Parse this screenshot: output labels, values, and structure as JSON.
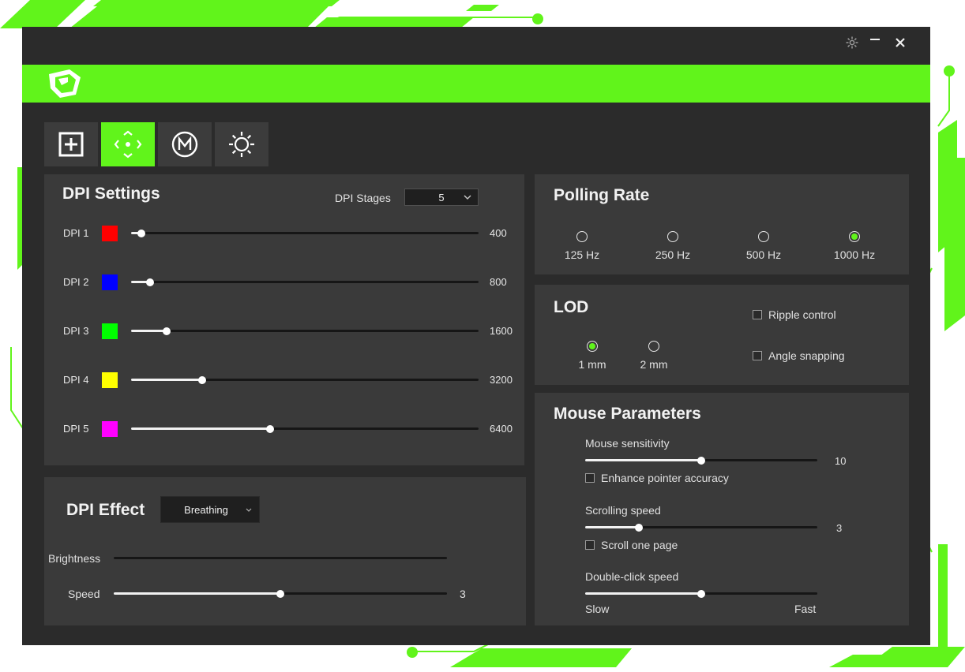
{
  "colors": {
    "accent": "#61f41b",
    "window_bg": "#2b2b2b",
    "panel_bg": "#3a3a3a"
  },
  "titlebar": {
    "icons": [
      "gear-icon",
      "minimize-icon",
      "close-icon"
    ]
  },
  "tabs": [
    {
      "icon": "plus-square-icon",
      "active": false
    },
    {
      "icon": "move-arrows-icon",
      "active": true
    },
    {
      "icon": "macro-m-icon",
      "active": false
    },
    {
      "icon": "sun-light-icon",
      "active": false
    }
  ],
  "dpi_settings": {
    "title": "DPI Settings",
    "stages_label": "DPI Stages",
    "stages_value": "5",
    "rows": [
      {
        "label": "DPI 1",
        "color": "#ff0000",
        "value": "400",
        "fraction": 0.03
      },
      {
        "label": "DPI 2",
        "color": "#0000ff",
        "value": "800",
        "fraction": 0.055
      },
      {
        "label": "DPI 3",
        "color": "#00ff00",
        "value": "1600",
        "fraction": 0.103
      },
      {
        "label": "DPI 4",
        "color": "#ffff00",
        "value": "3200",
        "fraction": 0.205
      },
      {
        "label": "DPI 5",
        "color": "#ff00ff",
        "value": "6400",
        "fraction": 0.4
      }
    ]
  },
  "dpi_effect": {
    "title": "DPI Effect",
    "mode": "Breathing",
    "brightness_label": "Brightness",
    "speed_label": "Speed",
    "speed_value": "3",
    "speed_fraction": 0.5
  },
  "polling_rate": {
    "title": "Polling Rate",
    "options": [
      {
        "label": "125 Hz",
        "selected": false
      },
      {
        "label": "250 Hz",
        "selected": false
      },
      {
        "label": "500 Hz",
        "selected": false
      },
      {
        "label": "1000 Hz",
        "selected": true
      }
    ]
  },
  "lod": {
    "title": "LOD",
    "options": [
      {
        "label": "1 mm",
        "selected": true
      },
      {
        "label": "2 mm",
        "selected": false
      }
    ],
    "ripple_label": "Ripple control",
    "ripple_checked": false,
    "angle_label": "Angle snapping",
    "angle_checked": false
  },
  "mouse_parameters": {
    "title": "Mouse Parameters",
    "sensitivity_label": "Mouse sensitivity",
    "sensitivity_value": "10",
    "sensitivity_fraction": 0.5,
    "enhance_label": "Enhance pointer accuracy",
    "enhance_checked": false,
    "scroll_label": "Scrolling speed",
    "scroll_value": "3",
    "scroll_fraction": 0.23,
    "scroll_page_label": "Scroll one page",
    "scroll_page_checked": false,
    "double_click_label": "Double-click speed",
    "double_click_fraction": 0.5,
    "slow_label": "Slow",
    "fast_label": "Fast"
  }
}
